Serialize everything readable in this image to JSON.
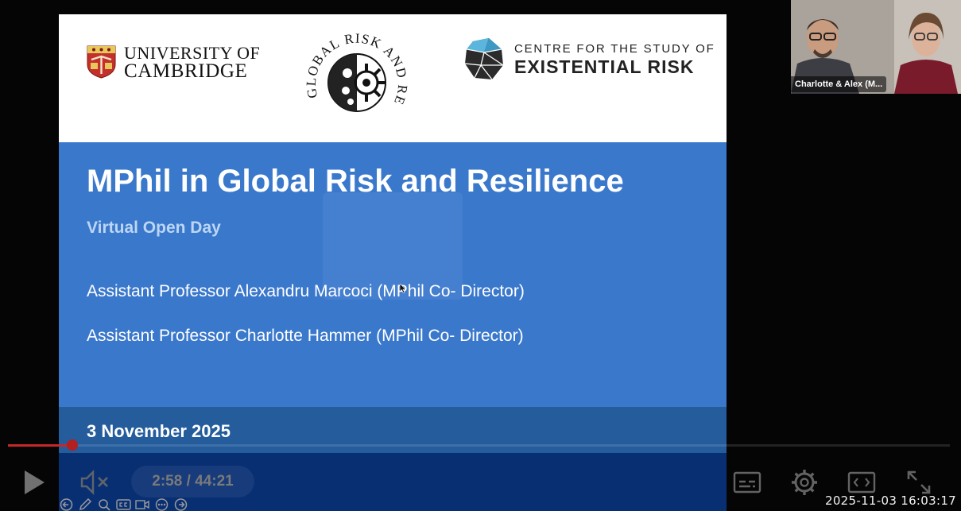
{
  "slide": {
    "university_line1": "UNIVERSITY OF",
    "university_line2": "CAMBRIDGE",
    "grr_logo_top_text": "GLOBAL RISK AND RESILIENCE",
    "cser_line1": "CENTRE FOR THE STUDY OF",
    "cser_line2": "EXISTENTIAL RISK",
    "title": "MPhil in Global Risk and Resilience",
    "subtitle": "Virtual Open Day",
    "presenters": [
      "Assistant Professor Alexandru Marcoci (MPhil Co- Director)",
      "Assistant Professor Charlotte Hammer (MPhil Co- Director)"
    ],
    "date": "3 November 2025",
    "colors": {
      "body_blue": "#3a78cc",
      "date_band": "#245c9c",
      "bottom_band": "#092f73",
      "subtitle": "#bcd6f4"
    }
  },
  "participant": {
    "label": "Charlotte & Alex (M..."
  },
  "player": {
    "time": "2:58 / 44:21",
    "progress_fraction": 0.067,
    "accent": "#c42828",
    "icons": [
      "play-icon",
      "mute-icon",
      "captions-icon",
      "settings-icon",
      "picture-in-picture-icon",
      "fullscreen-icon"
    ],
    "mini_toolbar_icons": [
      "back-arrow-icon",
      "pencil-icon",
      "zoom-icon",
      "cc-icon",
      "video-icon",
      "more-icon",
      "forward-arrow-icon"
    ]
  },
  "overlay": {
    "timestamp": "2025-11-03  16:03:17"
  }
}
